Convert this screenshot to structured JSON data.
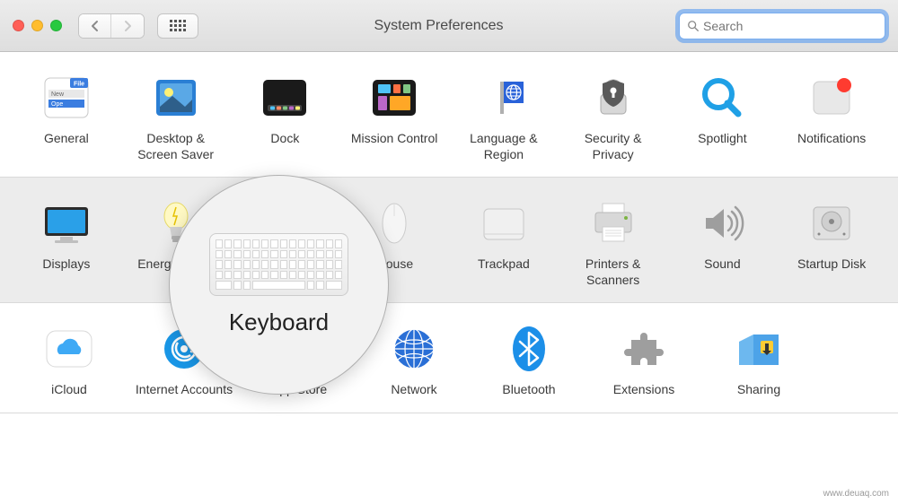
{
  "window": {
    "title": "System Preferences"
  },
  "search": {
    "placeholder": "Search"
  },
  "rows": [
    {
      "items": [
        {
          "id": "general",
          "label": "General"
        },
        {
          "id": "desktop",
          "label": "Desktop & Screen Saver"
        },
        {
          "id": "dock",
          "label": "Dock"
        },
        {
          "id": "mission",
          "label": "Mission Control"
        },
        {
          "id": "language",
          "label": "Language & Region"
        },
        {
          "id": "security",
          "label": "Security & Privacy"
        },
        {
          "id": "spotlight",
          "label": "Spotlight"
        },
        {
          "id": "notifications",
          "label": "Notifications"
        }
      ]
    },
    {
      "items": [
        {
          "id": "displays",
          "label": "Displays"
        },
        {
          "id": "energy",
          "label": "Energy Saver"
        },
        {
          "id": "keyboard",
          "label": "Keyboard"
        },
        {
          "id": "mouse",
          "label": "Mouse"
        },
        {
          "id": "trackpad",
          "label": "Trackpad"
        },
        {
          "id": "printers",
          "label": "Printers & Scanners"
        },
        {
          "id": "sound",
          "label": "Sound"
        },
        {
          "id": "startup",
          "label": "Startup Disk"
        }
      ]
    },
    {
      "items": [
        {
          "id": "icloud",
          "label": "iCloud"
        },
        {
          "id": "internet",
          "label": "Internet Accounts"
        },
        {
          "id": "appstore",
          "label": "App Store"
        },
        {
          "id": "network",
          "label": "Network"
        },
        {
          "id": "bluetooth",
          "label": "Bluetooth"
        },
        {
          "id": "extensions",
          "label": "Extensions"
        },
        {
          "id": "sharing",
          "label": "Sharing"
        }
      ]
    }
  ],
  "lens": {
    "label": "Keyboard"
  },
  "watermark": "www.deuaq.com"
}
